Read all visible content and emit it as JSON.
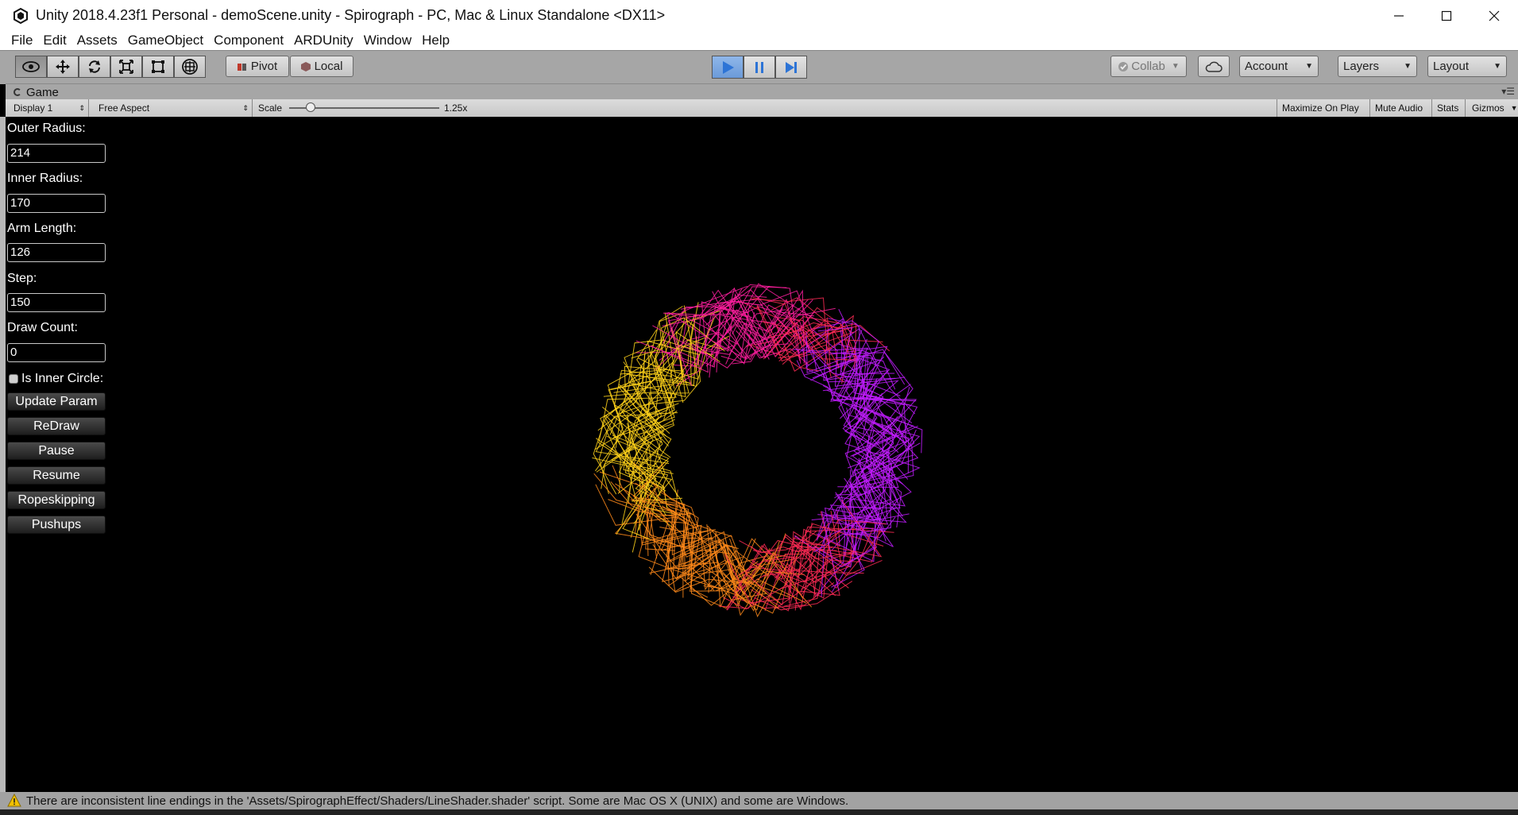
{
  "window": {
    "title": "Unity 2018.4.23f1 Personal - demoScene.unity - Spirograph - PC, Mac & Linux Standalone <DX11>",
    "controls": [
      "minimize-icon",
      "maximize-icon",
      "close-icon"
    ]
  },
  "menu": {
    "items": [
      "File",
      "Edit",
      "Assets",
      "GameObject",
      "Component",
      "ARDUnity",
      "Window",
      "Help"
    ]
  },
  "toolbar": {
    "tools": [
      "hand-tool-icon",
      "move-tool-icon",
      "rotate-tool-icon",
      "scale-tool-icon",
      "rect-tool-icon",
      "transform-tool-icon"
    ],
    "pivot_label": "Pivot",
    "local_label": "Local",
    "collab_label": "Collab",
    "account_label": "Account",
    "layers_label": "Layers",
    "layout_label": "Layout",
    "play_active": true,
    "accent": "#3b7fd6"
  },
  "game_tab": {
    "label": "Game",
    "display": "Display 1",
    "aspect": "Free Aspect",
    "scale_label": "Scale",
    "scale_value": "1.25x",
    "maximize": "Maximize On Play",
    "mute": "Mute Audio",
    "stats": "Stats",
    "gizmos": "Gizmos"
  },
  "panel": {
    "outer_radius_label": "Outer Radius:",
    "outer_radius_value": "214",
    "inner_radius_label": "Inner Radius:",
    "inner_radius_value": "170",
    "arm_length_label": "Arm Length:",
    "arm_length_value": "126",
    "step_label": "Step:",
    "step_value": "150",
    "draw_count_label": "Draw Count:",
    "draw_count_value": "0",
    "is_inner_circle_label": "Is Inner Circle:",
    "is_inner_circle": true,
    "buttons": [
      "Update Param",
      "ReDraw",
      "Pause",
      "Resume",
      "Ropeskipping",
      "Pushups"
    ]
  },
  "spirograph": {
    "colors": [
      "#ffd21a",
      "#ff8a1a",
      "#ff2a55",
      "#c21cff",
      "#ff1fa0"
    ]
  },
  "status": {
    "message": "There are inconsistent line endings in the 'Assets/SpirographEffect/Shaders/LineShader.shader' script. Some are Mac OS X (UNIX) and some are Windows.",
    "icon": "warning-icon",
    "color": "#f2c100"
  }
}
